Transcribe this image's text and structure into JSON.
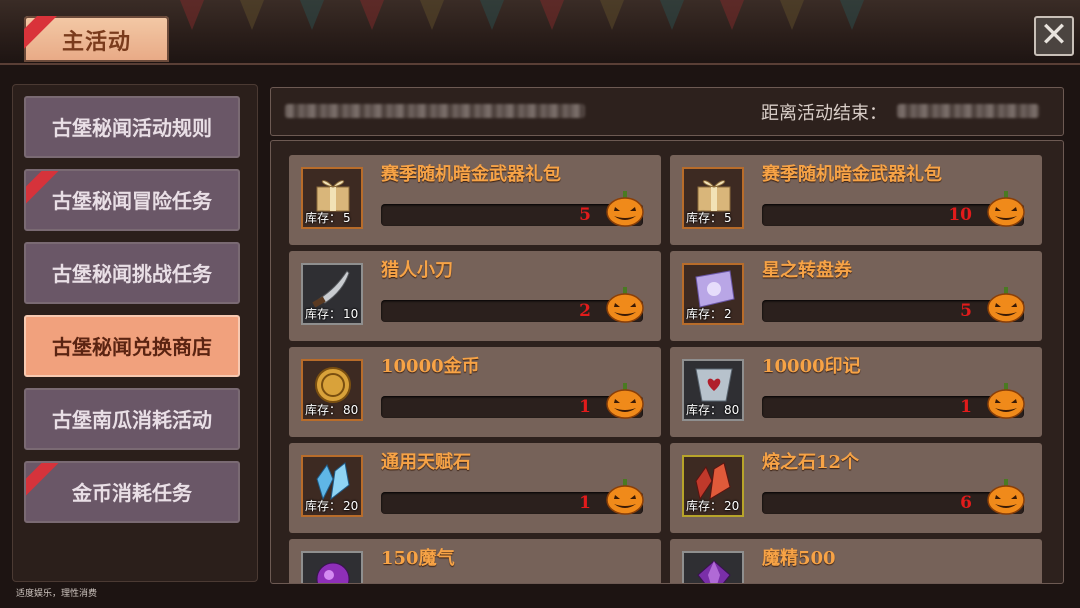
{
  "header": {
    "title": "主活动",
    "close_glyph": "✕"
  },
  "sidebar": {
    "items": [
      {
        "label": "古堡秘闻活动规则",
        "active": false,
        "badge": false
      },
      {
        "label": "古堡秘闻冒险任务",
        "active": false,
        "badge": true
      },
      {
        "label": "古堡秘闻挑战任务",
        "active": false,
        "badge": false
      },
      {
        "label": "古堡秘闻兑换商店",
        "active": true,
        "badge": false
      },
      {
        "label": "古堡南瓜消耗活动",
        "active": false,
        "badge": false
      },
      {
        "label": "金币消耗任务",
        "active": false,
        "badge": true
      }
    ],
    "footnote": "适度娱乐，理性消费"
  },
  "info_bar": {
    "countdown_label": "距离活动结束："
  },
  "stock_label": "库存：",
  "currency_icon": "pumpkin-icon",
  "colors": {
    "accent": "#f7a346",
    "price": "#e21b1b",
    "active_tab": "#f1a17d",
    "badge": "#d6333b"
  },
  "shop": {
    "items": [
      {
        "name": "赛季随机暗金武器礼包",
        "stock": "5",
        "price": "5",
        "icon": "gift-box-icon"
      },
      {
        "name": "赛季随机暗金武器礼包",
        "stock": "5",
        "price": "10",
        "icon": "gift-box-icon"
      },
      {
        "name": "猎人小刀",
        "stock": "10",
        "price": "2",
        "icon": "knife-icon"
      },
      {
        "name": "星之转盘券",
        "stock": "2",
        "price": "5",
        "icon": "ticket-icon"
      },
      {
        "name": "10000金币",
        "stock": "80",
        "price": "1",
        "icon": "gold-coin-icon"
      },
      {
        "name": "10000印记",
        "stock": "80",
        "price": "1",
        "icon": "emblem-icon"
      },
      {
        "name": "通用天赋石",
        "stock": "20",
        "price": "1",
        "icon": "blue-crystal-icon"
      },
      {
        "name": "熔之石12个",
        "stock": "20",
        "price": "6",
        "icon": "red-crystal-icon"
      },
      {
        "name": "150魔气",
        "icon": "purple-orb-icon"
      },
      {
        "name": "魔精500",
        "icon": "purple-gem-icon"
      }
    ]
  }
}
